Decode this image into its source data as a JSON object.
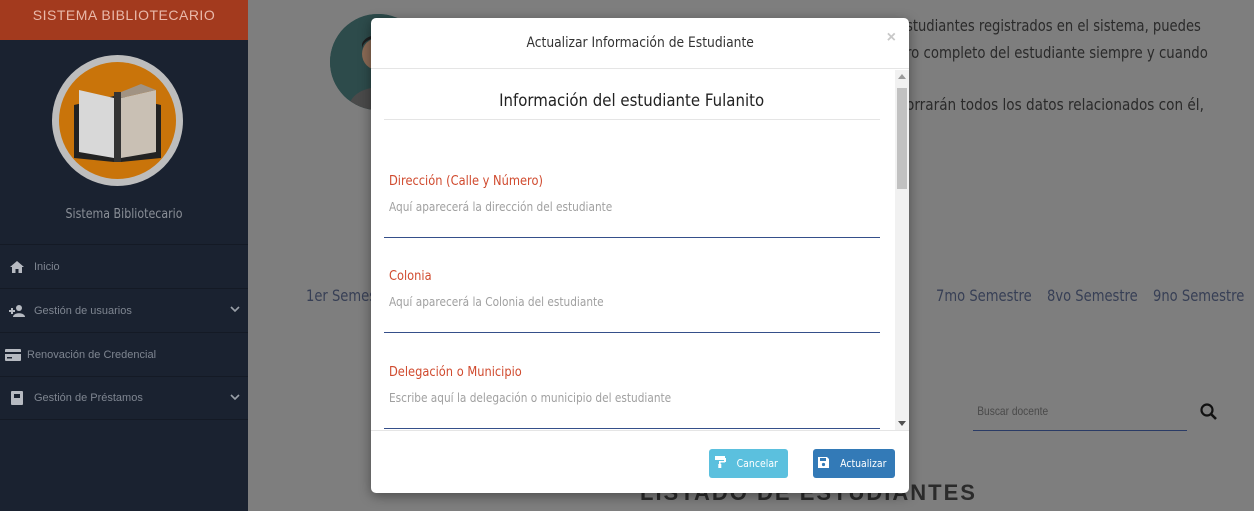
{
  "sidebar": {
    "brand": "SISTEMA BIBLIOTECARIO",
    "subtitle": "Sistema Bibliotecario",
    "items": [
      {
        "label": "Inicio",
        "icon": "home-icon"
      },
      {
        "label": "Gestión de usuarios",
        "icon": "add-user-icon",
        "has_submenu": true
      },
      {
        "label": "Renovación de Credencial",
        "icon": "credit-card-icon"
      },
      {
        "label": "Gestión de Préstamos",
        "icon": "book-icon",
        "has_submenu": true
      }
    ]
  },
  "background": {
    "para_line1": "studiantes registrados en el sistema, puedes",
    "para_line2": "ro completo del estudiante siempre y cuando",
    "para_line3": "orrarán todos los datos relacionados con él,",
    "semesters": [
      "1er Semest",
      "7mo Semestre",
      "8vo Semestre",
      "9no Semestre"
    ],
    "search_placeholder": "Buscar docente",
    "bottom_heading": "LISTADO DE ESTUDIANTES"
  },
  "modal": {
    "title": "Actualizar Información de Estudiante",
    "close": "×",
    "section_title": "Información del estudiante Fulanito",
    "fields": [
      {
        "label": "Dirección (Calle y Número)",
        "placeholder": "Aquí aparecerá la dirección del estudiante"
      },
      {
        "label": "Colonia",
        "placeholder": "Aquí aparecerá la Colonia del estudiante"
      },
      {
        "label": "Delegación o Municipio",
        "placeholder": "Escribe aquí la delegación o municipio del estudiante"
      }
    ],
    "buttons": {
      "cancel": "Cancelar",
      "update": "Actualizar"
    }
  },
  "colors": {
    "sidebar_bg": "#1a2230",
    "brand_bg": "#a33a1e",
    "label_red": "#d04a2e",
    "cancel_btn": "#5bc0de",
    "update_btn": "#337ab7"
  }
}
